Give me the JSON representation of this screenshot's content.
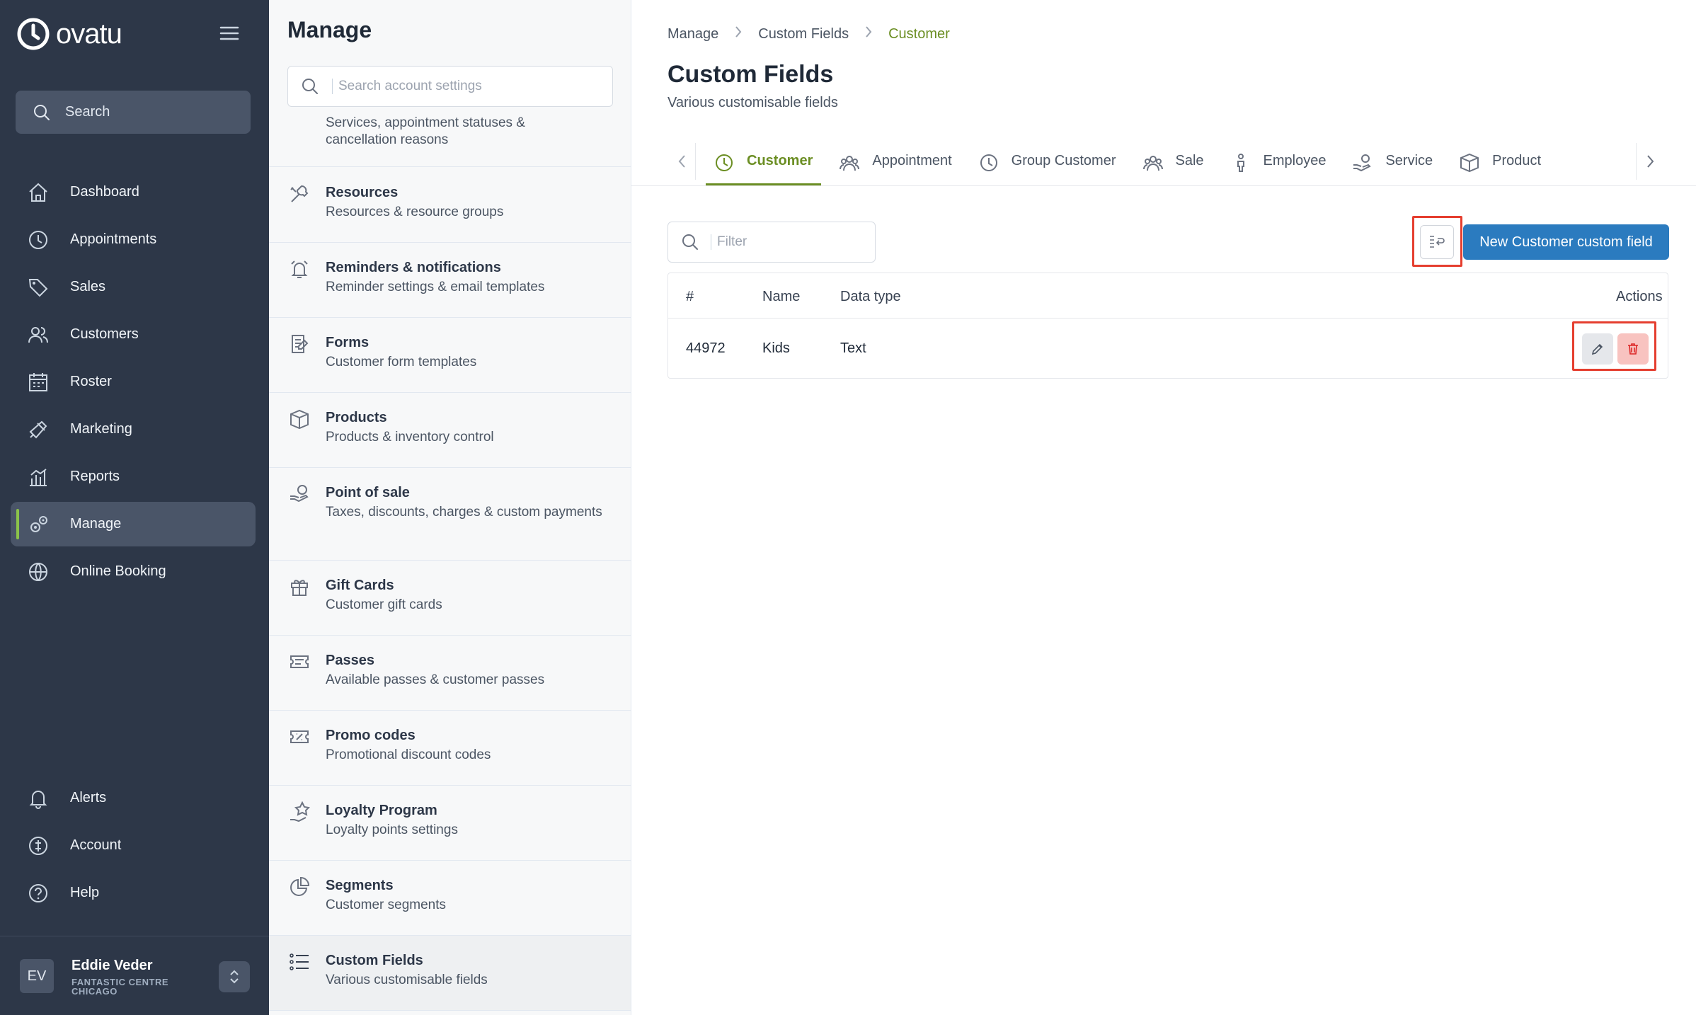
{
  "app": {
    "brand": "ovatu"
  },
  "sidebar": {
    "search_label": "Search",
    "items": [
      {
        "label": "Dashboard",
        "icon": "home-icon"
      },
      {
        "label": "Appointments",
        "icon": "clock-icon"
      },
      {
        "label": "Sales",
        "icon": "tag-icon"
      },
      {
        "label": "Customers",
        "icon": "users-icon"
      },
      {
        "label": "Roster",
        "icon": "calendar-icon"
      },
      {
        "label": "Marketing",
        "icon": "megaphone-icon"
      },
      {
        "label": "Reports",
        "icon": "chart-icon"
      },
      {
        "label": "Manage",
        "icon": "gears-icon",
        "active": true
      },
      {
        "label": "Online Booking",
        "icon": "globe-icon"
      }
    ],
    "bottom_items": [
      {
        "label": "Alerts",
        "icon": "bell-icon"
      },
      {
        "label": "Account",
        "icon": "account-icon"
      },
      {
        "label": "Help",
        "icon": "help-icon"
      }
    ],
    "user": {
      "initials": "EV",
      "name": "Eddie Veder",
      "org": "FANTASTIC CENTRE CHICAGO"
    }
  },
  "manage": {
    "title": "Manage",
    "search_placeholder": "Search account settings",
    "partial_desc": "Services, appointment statuses & cancellation reasons",
    "items": [
      {
        "title": "Resources",
        "desc": "Resources & resource groups",
        "icon": "tools-icon"
      },
      {
        "title": "Reminders & notifications",
        "desc": "Reminder settings & email templates",
        "icon": "alarm-icon"
      },
      {
        "title": "Forms",
        "desc": "Customer form templates",
        "icon": "form-icon"
      },
      {
        "title": "Products",
        "desc": "Products & inventory control",
        "icon": "box-icon"
      },
      {
        "title": "Point of sale",
        "desc": "Taxes, discounts, charges & custom payments",
        "icon": "pos-icon"
      },
      {
        "title": "Gift Cards",
        "desc": "Customer gift cards",
        "icon": "gift-icon"
      },
      {
        "title": "Passes",
        "desc": "Available passes & customer passes",
        "icon": "ticket-icon"
      },
      {
        "title": "Promo codes",
        "desc": "Promotional discount codes",
        "icon": "promo-icon"
      },
      {
        "title": "Loyalty Program",
        "desc": "Loyalty points settings",
        "icon": "loyalty-icon"
      },
      {
        "title": "Segments",
        "desc": "Customer segments",
        "icon": "pie-icon"
      },
      {
        "title": "Custom Fields",
        "desc": "Various customisable fields",
        "icon": "list-icon",
        "active": true
      }
    ]
  },
  "main": {
    "breadcrumb": [
      "Manage",
      "Custom Fields",
      "Customer"
    ],
    "title": "Custom Fields",
    "subtitle": "Various customisable fields",
    "tabs": [
      {
        "label": "Customer",
        "icon": "clock-icon",
        "active": true
      },
      {
        "label": "Appointment",
        "icon": "group-icon"
      },
      {
        "label": "Group Customer",
        "icon": "clock-icon"
      },
      {
        "label": "Sale",
        "icon": "group-icon"
      },
      {
        "label": "Employee",
        "icon": "person-icon"
      },
      {
        "label": "Service",
        "icon": "service-icon"
      },
      {
        "label": "Product",
        "icon": "box-icon"
      }
    ],
    "filter_placeholder": "Filter",
    "new_button": "New Customer custom field",
    "table": {
      "headers": [
        "#",
        "Name",
        "Data type",
        "Actions"
      ],
      "rows": [
        {
          "id": "44972",
          "name": "Kids",
          "type": "Text"
        }
      ]
    }
  },
  "colors": {
    "sidebar_bg": "#2d3748",
    "accent_green": "#6b8e23",
    "primary_blue": "#2b7bbf",
    "highlight_red": "#e53e2f"
  }
}
